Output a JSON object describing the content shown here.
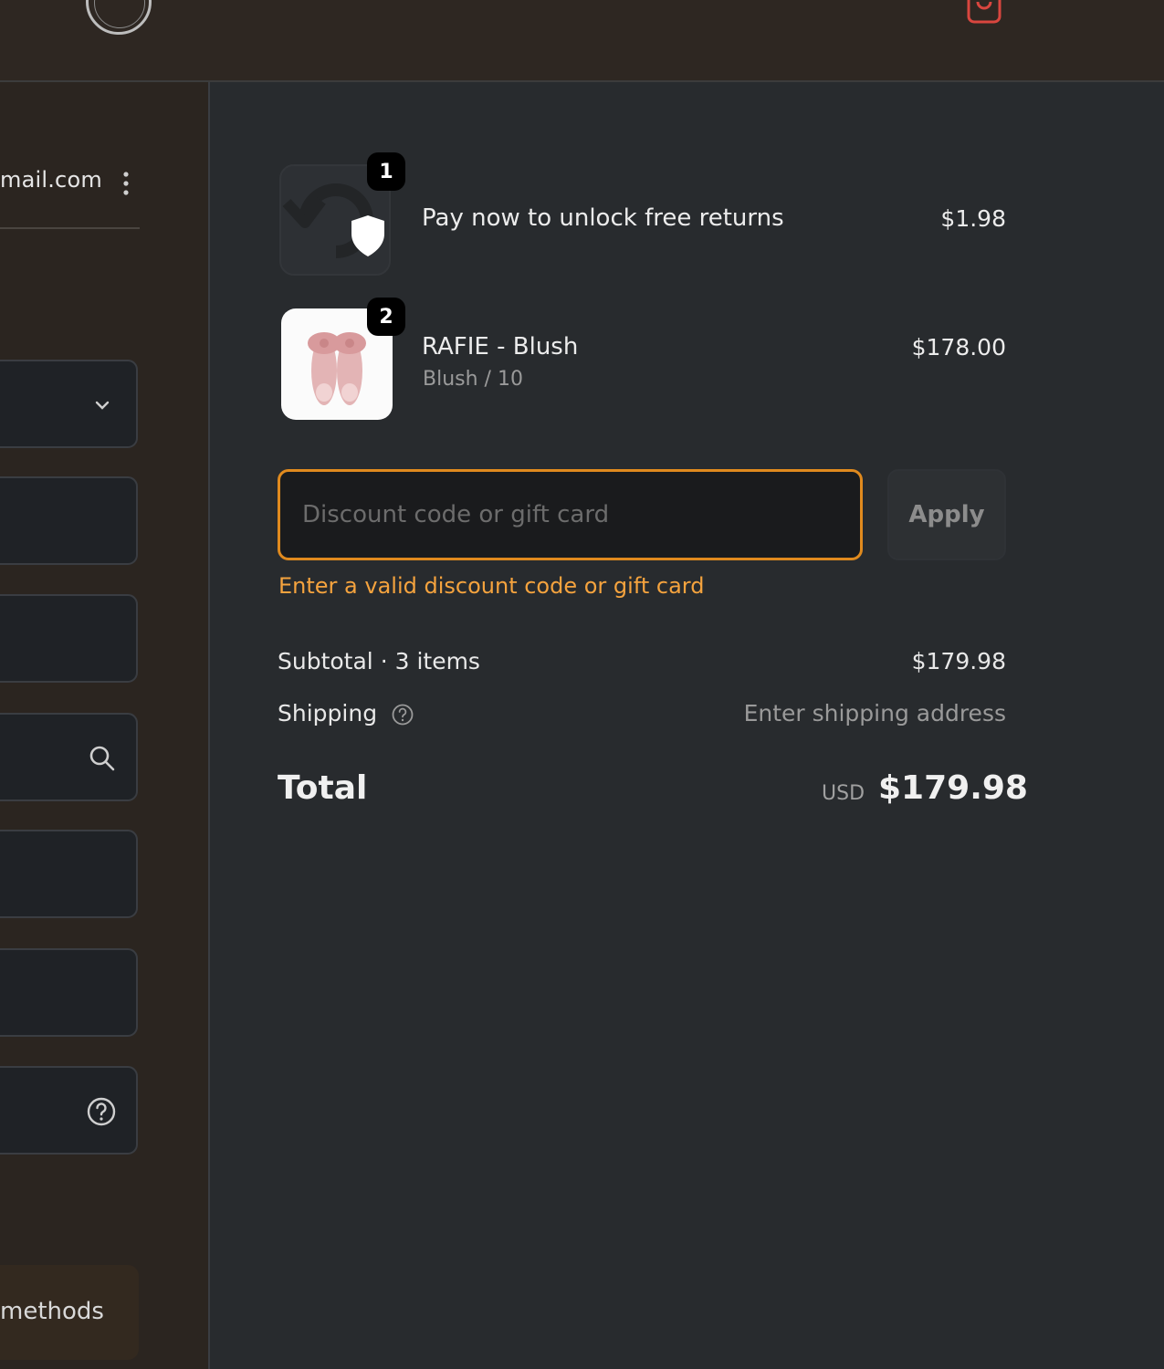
{
  "header": {
    "logo_icon": "brand-seal-logo",
    "cart_icon": "shopping-bag-icon",
    "cart_color": "#d9463f"
  },
  "left": {
    "account_email": "mail.com",
    "menu_icon": "kebab-menu-icon",
    "fields": [
      {
        "icon": "chevron-down-icon"
      },
      {
        "icon": ""
      },
      {
        "icon": ""
      },
      {
        "icon": "search-icon"
      },
      {
        "icon": ""
      },
      {
        "icon": ""
      },
      {
        "icon": "help-circle-icon"
      }
    ],
    "methods_label": "methods"
  },
  "order": {
    "lines": [
      {
        "quantity": "1",
        "name": "Pay now to unlock free returns",
        "variant": "",
        "price": "$1.98",
        "image": "returns-shield-icon"
      },
      {
        "quantity": "2",
        "name": "RAFIE - Blush",
        "variant": "Blush / 10",
        "price": "$178.00",
        "image": "pink-bow-slide-sandals"
      }
    ]
  },
  "discount": {
    "placeholder": "Discount code or gift card",
    "value": "",
    "apply_label": "Apply",
    "error": "Enter a valid discount code or gift card",
    "accent_color": "#e08a1e"
  },
  "summary": {
    "subtotal_label": "Subtotal · 3 items",
    "subtotal_value": "$179.98",
    "shipping_label": "Shipping",
    "shipping_value": "Enter shipping address",
    "total_label": "Total",
    "currency": "USD",
    "total_value": "$179.98"
  }
}
